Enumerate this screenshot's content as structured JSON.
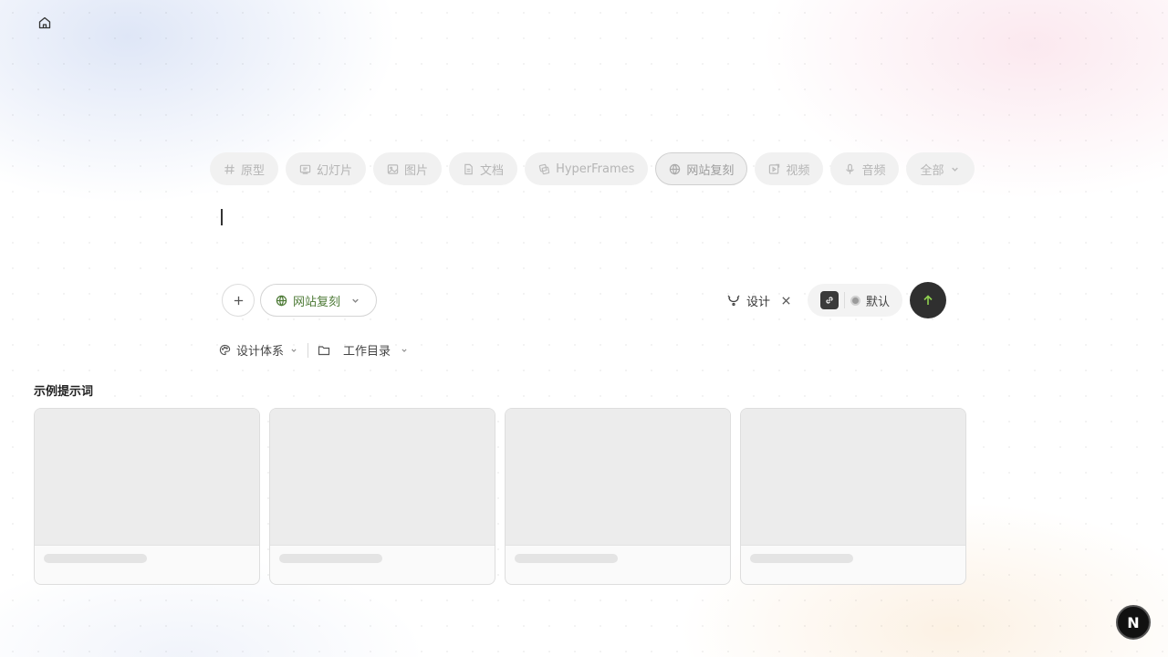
{
  "nav": {
    "home_icon": "home-icon"
  },
  "chips": [
    {
      "label": "原型",
      "icon": "hash-icon"
    },
    {
      "label": "幻灯片",
      "icon": "slides-icon"
    },
    {
      "label": "图片",
      "icon": "image-icon"
    },
    {
      "label": "文档",
      "icon": "document-icon"
    },
    {
      "label": "HyperFrames",
      "icon": "hyperframes-icon"
    },
    {
      "label": "网站复刻",
      "icon": "globe-icon",
      "active": true
    },
    {
      "label": "视频",
      "icon": "video-icon"
    },
    {
      "label": "音频",
      "icon": "mic-icon"
    },
    {
      "label": "全部",
      "icon": "chevron-down-icon"
    }
  ],
  "composer": {
    "input_value": "",
    "add_button_icon": "plus-icon",
    "mode_label": "网站复刻",
    "design_label": "设计",
    "model_label": "默认",
    "send_icon": "arrow-up-icon"
  },
  "meta": {
    "design_system_label": "设计体系",
    "workdir_label": "工作目录"
  },
  "examples": {
    "title": "示例提示词",
    "cards": [
      {},
      {},
      {},
      {}
    ]
  },
  "floating": {
    "label": "N"
  },
  "colors": {
    "mode_green": "#4d7a36",
    "send_bg": "#2f2f2f",
    "send_arrow": "#8fd14f"
  }
}
